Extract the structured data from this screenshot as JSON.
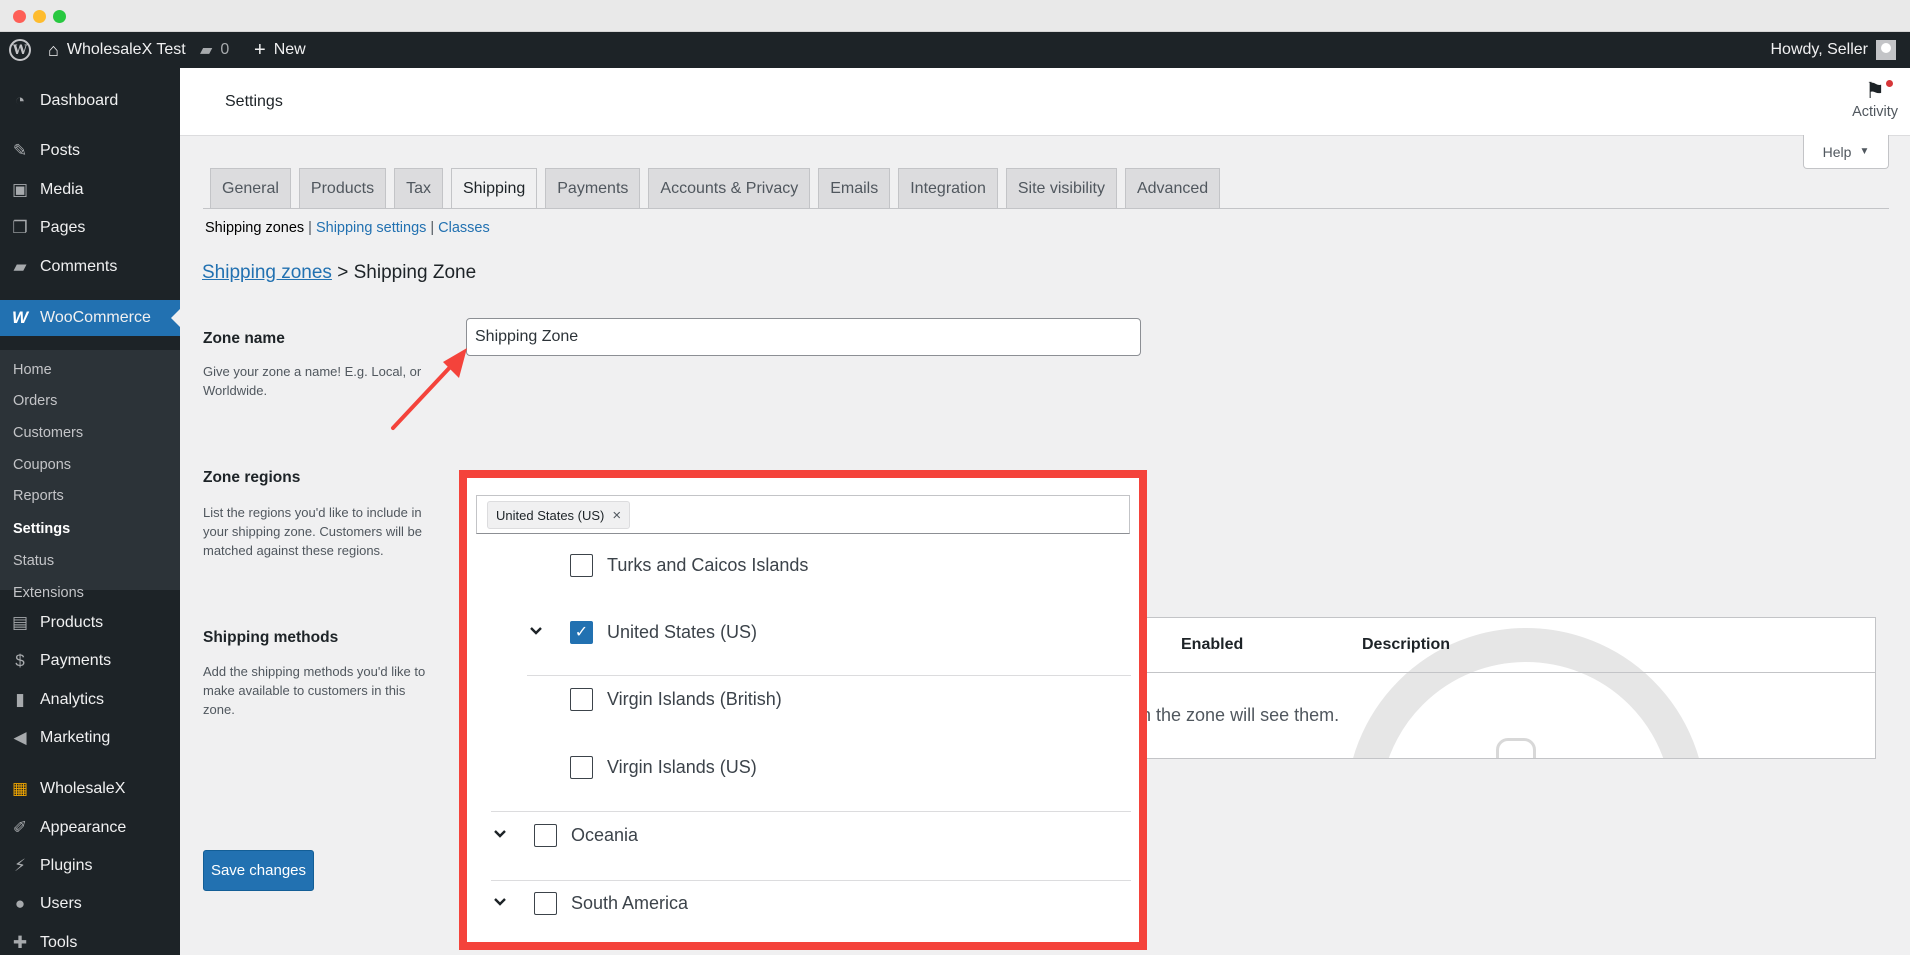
{
  "adminbar": {
    "site_name": "WholesaleX Test",
    "comments_count": "0",
    "new_label": "New",
    "howdy": "Howdy, Seller"
  },
  "sidebar": {
    "items": [
      {
        "label": "Dashboard",
        "icon": "dashboard-icon"
      },
      {
        "label": "Posts",
        "icon": "pin-icon"
      },
      {
        "label": "Media",
        "icon": "media-icon"
      },
      {
        "label": "Pages",
        "icon": "pages-icon"
      },
      {
        "label": "Comments",
        "icon": "comment-icon"
      },
      {
        "label": "WooCommerce",
        "icon": "woo-icon"
      },
      {
        "label": "Products",
        "icon": "products-icon"
      },
      {
        "label": "Payments",
        "icon": "payments-icon"
      },
      {
        "label": "Analytics",
        "icon": "chart-icon"
      },
      {
        "label": "Marketing",
        "icon": "megaphone-icon"
      },
      {
        "label": "WholesaleX",
        "icon": "wholesalex-icon"
      },
      {
        "label": "Appearance",
        "icon": "brush-icon"
      },
      {
        "label": "Plugins",
        "icon": "plug-icon"
      },
      {
        "label": "Users",
        "icon": "user-icon"
      },
      {
        "label": "Tools",
        "icon": "wrench-icon"
      }
    ],
    "woo_submenu": [
      "Home",
      "Orders",
      "Customers",
      "Coupons",
      "Reports",
      "Settings",
      "Status",
      "Extensions"
    ]
  },
  "header": {
    "title": "Settings",
    "activity": "Activity",
    "help": "Help"
  },
  "tabs": [
    "General",
    "Products",
    "Tax",
    "Shipping",
    "Payments",
    "Accounts & Privacy",
    "Emails",
    "Integration",
    "Site visibility",
    "Advanced"
  ],
  "active_tab": "Shipping",
  "subnav": {
    "current": "Shipping zones",
    "link1": "Shipping settings",
    "link2": "Classes",
    "sep": "|"
  },
  "breadcrumb": {
    "link": "Shipping zones",
    "sep": ">",
    "current": "Shipping Zone"
  },
  "zone_name": {
    "label": "Zone name",
    "desc": "Give your zone a name! E.g. Local, or Worldwide.",
    "value": "Shipping Zone"
  },
  "zone_regions": {
    "label": "Zone regions",
    "desc": "List the regions you'd like to include in your shipping zone. Customers will be matched against these regions.",
    "selected_chip": "United States (US)",
    "chip_remove": "×",
    "options": [
      {
        "label": "Turks and Caicos Islands",
        "checked": false
      },
      {
        "label": "United States (US)",
        "checked": true
      },
      {
        "label": "Virgin Islands (British)",
        "checked": false
      },
      {
        "label": "Virgin Islands (US)",
        "checked": false
      },
      {
        "label": "Oceania",
        "checked": false
      },
      {
        "label": "South America",
        "checked": false
      }
    ]
  },
  "shipping_methods": {
    "label": "Shipping methods",
    "desc": "Add the shipping methods you'd like to make available to customers in this zone.",
    "col_enabled": "Enabled",
    "col_description": "Description",
    "empty_text": "n the zone will see them."
  },
  "save_button": "Save changes",
  "colors": {
    "accent": "#2271b1",
    "sidebar": "#1d2327",
    "highlight_frame": "#f4433b",
    "arrow": "#f4433b"
  }
}
